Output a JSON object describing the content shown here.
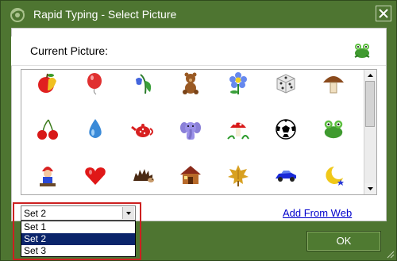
{
  "window": {
    "title": "Rapid Typing - Select Picture"
  },
  "header": {
    "label": "Current Picture:",
    "current_icon": "frog-icon"
  },
  "grid": {
    "rows": [
      [
        "apple-icon",
        "balloon-icon",
        "bluebell-flower-icon",
        "teddy-bear-icon",
        "blue-flower-icon",
        "dice-icon",
        "mushroom-icon"
      ],
      [
        "cherries-icon",
        "water-drop-icon",
        "teapot-icon",
        "elephant-icon",
        "toadstool-icon",
        "soccer-ball-icon",
        "frog-icon"
      ],
      [
        "gnome-icon",
        "heart-icon",
        "hedgehog-icon",
        "house-icon",
        "maple-leaf-icon",
        "car-icon",
        "crescent-moon-icon"
      ]
    ]
  },
  "set_select": {
    "value": "Set 2",
    "options": [
      "Set 1",
      "Set 2",
      "Set 3"
    ],
    "selected_index": 1
  },
  "link": {
    "label": "Add From Web"
  },
  "ok_button": {
    "label": "OK"
  },
  "colors": {
    "frame": "#4e7531",
    "selection": "#0a246a",
    "link": "#0000cc",
    "highlight": "#cc2020"
  }
}
